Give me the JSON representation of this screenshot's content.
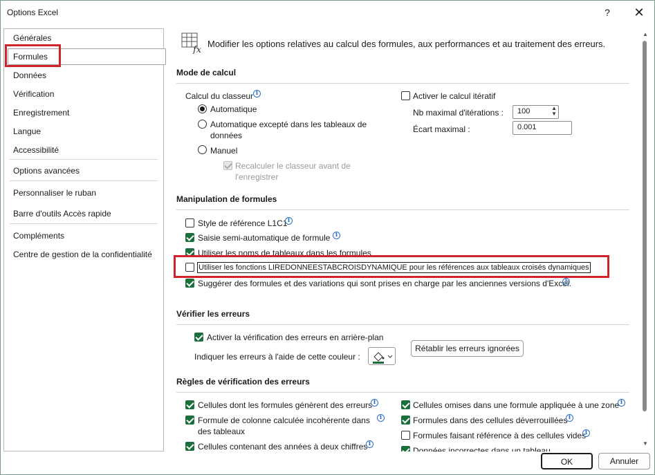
{
  "window": {
    "title": "Options Excel",
    "help": "?",
    "close": "✕"
  },
  "sidebar": {
    "items": [
      {
        "label": "Générales"
      },
      {
        "label": "Formules"
      },
      {
        "label": "Données"
      },
      {
        "label": "Vérification"
      },
      {
        "label": "Enregistrement"
      },
      {
        "label": "Langue"
      },
      {
        "label": "Accessibilité"
      },
      {
        "label": "Options avancées"
      },
      {
        "label": "Personnaliser le ruban"
      },
      {
        "label": "Barre d'outils Accès rapide"
      },
      {
        "label": "Compléments"
      },
      {
        "label": "Centre de gestion de la confidentialité"
      }
    ],
    "selected": "Formules"
  },
  "header": {
    "description": "Modifier les options relatives au calcul des formules, aux performances et au traitement des erreurs."
  },
  "calc": {
    "section": "Mode de calcul",
    "workbook_label": "Calcul du classeur",
    "auto": "Automatique",
    "auto_except_1": "Automatique excepté dans les tableaux de",
    "auto_except_2": "données",
    "manual": "Manuel",
    "recalc_1": "Recalculer le classeur avant de",
    "recalc_2": "l'enregistrer",
    "iterative": "Activer le calcul itératif",
    "max_iter_label": "Nb maximal d'itérations :",
    "max_iter_value": "100",
    "max_change_label": "Écart maximal :",
    "max_change_value": "0.001"
  },
  "formulas": {
    "section": "Manipulation de formules",
    "r1c1": "Style de référence L1C1",
    "autocomplete": "Saisie semi-automatique de formule",
    "table_names": "Utiliser les noms de tableaux dans les formules",
    "getpivot": "Utiliser les fonctions LIREDONNEESTABCROISDYNAMIQUE pour les références aux tableaux croisés dynamiques",
    "suggest": "Suggérer des formules et des variations qui sont prises en charge par les anciennes versions d'Excel."
  },
  "errors": {
    "section": "Vérifier les erreurs",
    "background": "Activer la vérification des erreurs en arrière-plan",
    "color_label": "Indiquer les erreurs à l'aide de cette couleur :",
    "reset": "Rétablir les erreurs ignorées",
    "color": "#1a6f3a"
  },
  "rules": {
    "section": "Règles de vérification des erreurs",
    "left": [
      {
        "label": "Cellules dont les formules génèrent des erreurs"
      },
      {
        "label": "Formule de colonne calculée incohérente dans",
        "label2": "des tableaux"
      },
      {
        "label": "Cellules contenant des années à deux chiffres"
      }
    ],
    "right": [
      {
        "label": "Cellules omises dans une formule appliquée à une zone"
      },
      {
        "label": "Formules dans des cellules déverrouillées"
      },
      {
        "label": "Formules faisant référence à des cellules vides"
      },
      {
        "label": "Données incorrectes dans un tableau"
      }
    ]
  },
  "footer": {
    "ok": "OK",
    "cancel": "Annuler"
  },
  "colors": {
    "accent": "#1a6f3a",
    "highlight": "#d0232a"
  }
}
